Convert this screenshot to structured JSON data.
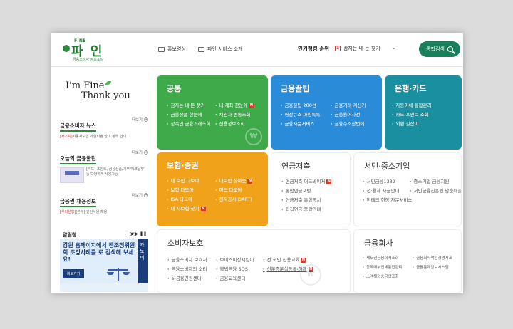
{
  "header": {
    "logo_top": "FINE",
    "logo_name": "파 인",
    "logo_sub": "금융소비자 정보포털",
    "nav": [
      "홍보영상",
      "파인 서비스 소개"
    ],
    "rank_title": "인기랭킹 순위",
    "rank_num": "1",
    "rank_item": "잠자는 내 돈 찾기",
    "rank_toggle": "⌄",
    "search_label": "통합검색"
  },
  "left": {
    "thanks_l1": "I'm Fine",
    "thanks_l2": "Thank you",
    "more_label": "더보기",
    "news_title": "금융소비자 뉴스",
    "news_tag": "[재조치]",
    "news_text": "자동차보험 과실비율 안내 정책 안내",
    "tips_title": "오늘의 금융꿀팁",
    "tips_text": "[카드] 포인트, 금융상품/기부/체크납부 등 다양하게 사용가능",
    "jobs_title": "금융권 채용정보",
    "jobs_tag": "[우리은행]",
    "jobs_text": "[본부] 인턴사원 채용",
    "alert_title": "알림창",
    "alert_page": "3/3",
    "alert_ctrl": "◀ ▶ ❚❚",
    "banner_text": "감원 홈페이지에서 쟁조정위원회 조정사례를 로 검색해 보세요!",
    "banner_go": "바로가기",
    "banner2_text": "카 토 피"
  },
  "cards": {
    "common": {
      "title": "공통",
      "col1": [
        "잠자는 내 돈 찾기",
        "금융상품 한눈에",
        "상속인 금융거래조회"
      ],
      "col2": [
        "내 계좌 한눈에",
        "채권자 변동조회",
        "신용정보조회"
      ]
    },
    "tips": {
      "title": "금융꿀팁",
      "col1": [
        "금융꿀팁 200선",
        "영상뉴스 파인특톡",
        "금융자문서비스"
      ],
      "col2": [
        "금융거래 계산기",
        "금융용어사전",
        "금융주소한번에"
      ]
    },
    "bank": {
      "title": "은행·카드",
      "col1": [
        "자동이체 통합관리",
        "카드 포인트 조회",
        "외환 길잡이"
      ]
    },
    "insurance": {
      "title": "보험·증권",
      "col1": [
        "내 보험 다보여",
        "보험 다모아",
        "ISA 다모아",
        "내 차보험 찾기"
      ],
      "col2": [
        "내보험 찾아줌",
        "펀드 다모아",
        "전자공시(DART)"
      ]
    },
    "pension": {
      "title": "연금저축",
      "col1": [
        "연금저축 어드바이저",
        "통합연금포털",
        "연금저축 통합공시",
        "퇴직연금 종합안내"
      ]
    },
    "smb": {
      "title": "서민·중소기업",
      "col1": [
        "서민금융1332",
        "전·월세 자금안내",
        "펀테크 현장 자문서비스"
      ],
      "col2": [
        "중소기업 금융지원",
        "서민금융진흥원 맞춤대출"
      ]
    },
    "consumer": {
      "title": "소비자보호",
      "col1": [
        "금융소비자 보호처",
        "금융소비자의 소리",
        "e-금융민원센터"
      ],
      "col2": [
        "보이스피싱지킴이",
        "불법금융 SOS",
        "금융교육센터"
      ],
      "col3": [
        "전 국민 신용교육",
        "신분증분실등록-해제"
      ]
    },
    "company": {
      "title": "금융회사",
      "col1": [
        "제도권금융회사조회",
        "등록대부업체통합관리",
        "소액해외송금업조회"
      ],
      "col2": [
        "금융회사책임경영지표",
        "금융통계정보시스템"
      ]
    }
  },
  "colors": {
    "green": "#3eaa4a",
    "blue": "#2a8bd8",
    "teal": "#1a8f9f",
    "orange": "#f0a31a",
    "brand": "#1a7f5a"
  }
}
